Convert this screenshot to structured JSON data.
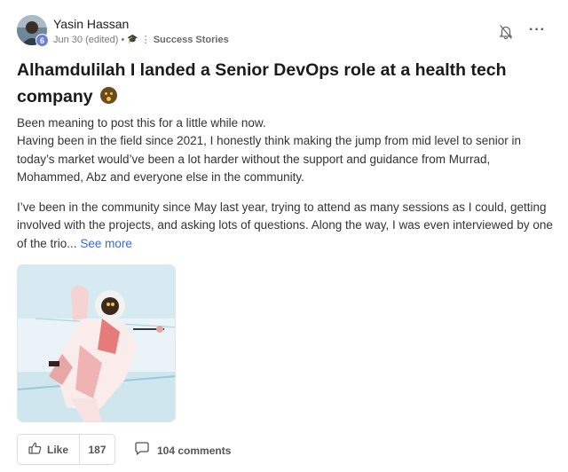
{
  "author": {
    "name": "Yasin Hassan",
    "level": "6",
    "date": "Jun 30 (edited)",
    "separator": "•",
    "category_emoji": "🎓",
    "category_sep": "⋮",
    "category": "Success Stories"
  },
  "post": {
    "title": "Alhamdulilah I landed a Senior DevOps role at a health tech company",
    "paragraph1_line1": "Been meaning to post this for a little while now.",
    "paragraph1_line2": "Having been in the field since 2021, I honestly think making the jump from mid level to senior in today’s market would’ve been a lot harder without the support and guidance from Murrad, Mohammed, Abz and everyone else in the community.",
    "paragraph2": "I’ve been in the community since May last year, trying to attend as many sessions as I could, getting involved with the projects, and asking lots of questions. Along the way, I was even interviewed by one of the trio...",
    "see_more": "See more"
  },
  "actions": {
    "like_label": "Like",
    "like_count": "187",
    "comments_label": "104 comments"
  },
  "icons": {
    "bell": "bell-off-icon",
    "more": "more-horizontal-icon",
    "like": "thumbs-up-icon",
    "comment": "comment-bubble-icon"
  },
  "colors": {
    "badge": "#6c7fe0",
    "link": "#3a6bc9"
  }
}
